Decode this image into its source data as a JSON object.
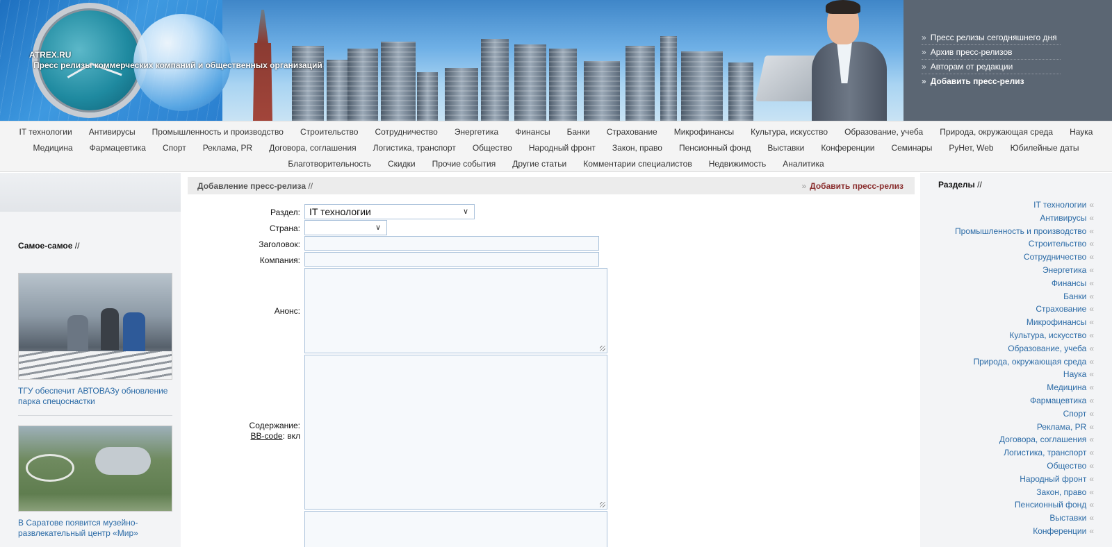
{
  "header": {
    "site": "ATREX.RU",
    "tagline": "Пресс релизы коммерческих компаний и общественных организаций",
    "menu": [
      "Пресс релизы сегодняшнего дня",
      "Архив пресс-релизов",
      "Авторам от редакции",
      "Добавить пресс-релиз"
    ],
    "menu_marker": "»"
  },
  "categories": {
    "row1": [
      "IT технологии",
      "Антивирусы",
      "Промышленность и производство",
      "Строительство",
      "Сотрудничество",
      "Энергетика",
      "Финансы",
      "Банки",
      "Страхование",
      "Микрофинансы",
      "Культура, искусство",
      "Образование, учеба",
      "Природа, окружающая среда",
      "Наука"
    ],
    "row2": [
      "Медицина",
      "Фармацевтика",
      "Спорт",
      "Реклама, PR",
      "Договора, соглашения",
      "Логистика, транспорт",
      "Общество",
      "Народный фронт",
      "Закон, право",
      "Пенсионный фонд",
      "Выставки",
      "Конференции",
      "Семинары",
      "РуНет, Web",
      "Юбилейные даты"
    ],
    "row3": [
      "Благотворительность",
      "Скидки",
      "Прочие события",
      "Другие статьи",
      "Комментарии специалистов",
      "Недвижимость",
      "Аналитика"
    ]
  },
  "left": {
    "heading": "Самое-самое",
    "sep": "//",
    "items": [
      {
        "caption": "ТГУ обеспечит АВТОВАЗу обновление парка спецоснастки"
      },
      {
        "caption": "В Саратове появится музейно-развлекательный центр «Мир»"
      }
    ]
  },
  "main": {
    "title": "Добавление пресс-релиза",
    "sep": "//",
    "action_marker": "»",
    "action": "Добавить пресс-релиз",
    "form": {
      "section_label": "Раздел:",
      "section_value": "IT технологии",
      "country_label": "Страна:",
      "country_value": "",
      "title_label": "Заголовок:",
      "company_label": "Компания:",
      "announce_label": "Анонс:",
      "content_label": "Содержание:",
      "bbcode_link": "BB-code",
      "bbcode_state": ": вкл"
    }
  },
  "right": {
    "heading": "Разделы",
    "sep": "//",
    "marker": "«",
    "items": [
      "IT технологии",
      "Антивирусы",
      "Промышленность и производство",
      "Строительство",
      "Сотрудничество",
      "Энергетика",
      "Финансы",
      "Банки",
      "Страхование",
      "Микрофинансы",
      "Культура, искусство",
      "Образование, учеба",
      "Природа, окружающая среда",
      "Наука",
      "Медицина",
      "Фармацевтика",
      "Спорт",
      "Реклама, PR",
      "Договора, соглашения",
      "Логистика, транспорт",
      "Общество",
      "Народный фронт",
      "Закон, право",
      "Пенсионный фонд",
      "Выставки",
      "Конференции"
    ]
  }
}
